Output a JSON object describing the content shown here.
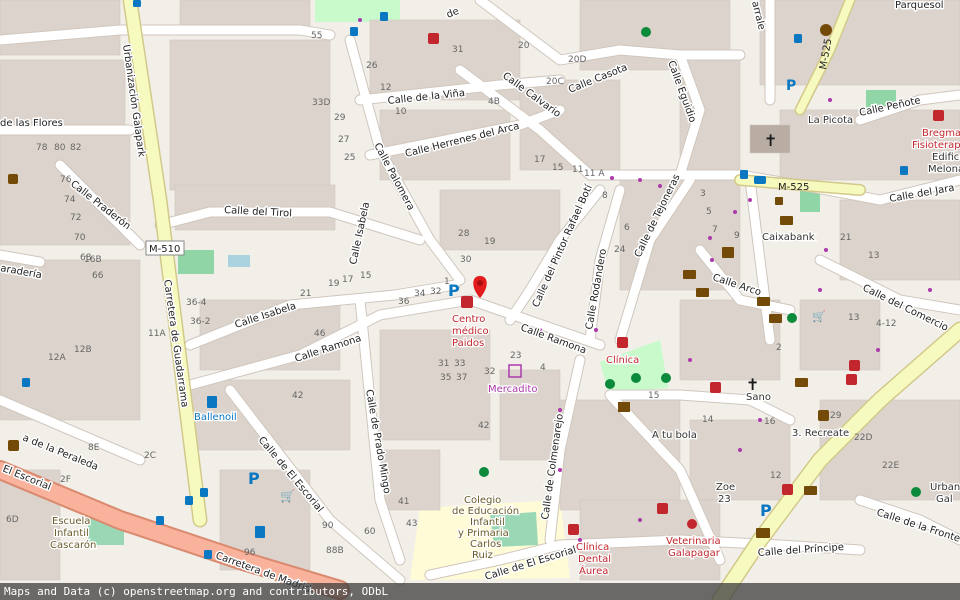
{
  "attribution": "Maps and Data (c) openstreetmap.org and contributors, ODbL",
  "colors": {
    "background": "#f2efe9",
    "building": "#d9d0c9",
    "road": "#ffffff",
    "major_road": "#f9b29c",
    "primary_road": "#f7fabf",
    "school_zone": "#fffbd6",
    "park": "#c8facc",
    "water": "#aad3df",
    "health": "#c2272d",
    "shop": "#ac39ac",
    "transit": "#0a77c2",
    "church": "#1b1b1b"
  },
  "streets": {
    "flores": "de las Flores",
    "galapark": "Urbanización Galapark",
    "praderon": "Calle Praderón",
    "pradera": "aradería",
    "tirol": "Calle del Tirol",
    "isabela_v": "Calle Isabela",
    "isabela_h": "Calle Isabela",
    "ramona_w": "Calle Ramona",
    "ramona_e": "Calle Ramona",
    "peraleda": "a de la Peraleda",
    "escorial_w": "El Escorial",
    "escorial_mid": "Calle de El Escorial",
    "escorial_s": "Calle de El Escorial",
    "guadarrama": "Carretera de Guadarrama",
    "madrid": "Carretera de Madrid",
    "prado_mingo": "Calle de Prado Mingo",
    "palomera": "Calle Palomera",
    "vina": "Calle de la Viña",
    "herrenes": "Calle Herrenes del Arca",
    "calvario": "Calle Calvario",
    "casota": "Calle Casota",
    "eguidio": "Calle Eguidio",
    "pintor": "Calle del Pintor Rafael Botí",
    "rodandero": "Calle Rodandero",
    "tejoneras": "Calle de Tejoneras",
    "arco": "Calle Arco",
    "colmenarejo": "Calle de Colmenarejo",
    "penote": "Calle Peñote",
    "jara": "Calle del Jara",
    "comercio": "Calle del Comercio",
    "principe": "Calle del Príncipe",
    "frontera": "Calle de la Fronte",
    "parque": "Parquesol",
    "arrale": "arrale",
    "de": "de"
  },
  "refs": {
    "m510": "M-510",
    "m525_top": "M-525",
    "m525": "M-525"
  },
  "pois": {
    "centro1": "Centro",
    "centro2": "médico",
    "centro3": "Paidos",
    "mercadito": "Mercadito",
    "clinica": "Clínica",
    "ballenoil": "Ballenoil",
    "caixabank": "Caixabank",
    "sano": "Sano",
    "atubola": "A tu bola",
    "recreate": "3. Recreate",
    "zoe1": "Zoe",
    "zoe2": "23",
    "picota": "La Picota",
    "bregma1": "Bregma",
    "bregma2": "Fisioterap",
    "edif1": "Edific",
    "edif2": "Melona",
    "urban1": "Urban",
    "urban2": "Gal",
    "colegio1": "Colegio",
    "colegio2": "de Educación",
    "colegio3": "Infantil",
    "colegio4": "y Primaria",
    "colegio5": "Carlos",
    "colegio6": "Ruiz",
    "escuela1": "Escuela",
    "escuela2": "Infantil",
    "escuela3": "Cascarón",
    "cd1": "Clínica",
    "cd2": "Dental",
    "cd3": "Áurea",
    "vet1": "Veterinaria",
    "vet2": "Galapagar"
  },
  "house_numbers": {
    "h1": "55",
    "h2": "31",
    "h3": "26",
    "h4": "12",
    "h5": "10",
    "h6": "33D",
    "h7": "29",
    "h8": "27",
    "h9": "25",
    "h10": "20",
    "h11": "4B",
    "h12": "20D",
    "h13": "20C",
    "h14": "19",
    "h15": "17",
    "h16": "15",
    "h17": "11",
    "h18": "11 A",
    "h19": "3",
    "h20": "5",
    "h21": "7",
    "h22": "9",
    "h23": "13",
    "h24": "15",
    "h25": "8",
    "h26": "6",
    "h27": "4",
    "h28": "2",
    "h29": "24",
    "h30": "28",
    "h31": "30",
    "h32": "1",
    "h33": "32",
    "h34": "34",
    "h35": "36",
    "h36": "78",
    "h37": "80",
    "h38": "82",
    "h39": "76",
    "h40": "74",
    "h41": "72",
    "h42": "70",
    "h43": "68",
    "h44": "66",
    "h45": "16B",
    "h46": "12B",
    "h47": "12A",
    "h48": "11A",
    "h49": "36-4",
    "h50": "36-2",
    "h51": "46",
    "h52": "42",
    "h53": "21",
    "h54": "19",
    "h55": "17",
    "h56": "15",
    "h57": "31",
    "h58": "33",
    "h59": "35",
    "h60": "37",
    "h61": "23",
    "h62": "32",
    "h63": "42",
    "h64": "41",
    "h65": "43",
    "h66": "90",
    "h67": "88B",
    "h68": "96",
    "h69": "60",
    "h70": "29",
    "h71": "22D",
    "h72": "22E",
    "h73": "16",
    "h74": "14",
    "h75": "4-12",
    "h76": "13",
    "h77": "21",
    "h78": "6D",
    "h79": "8E",
    "h80": "2C",
    "h81": "2F",
    "h82": "12"
  },
  "icons": [
    "bus-stop-icon",
    "parking-icon",
    "pharmacy-icon",
    "church-icon",
    "bank-icon",
    "atm-icon",
    "playground-icon",
    "fuel-icon",
    "shopping-cart-icon",
    "map-marker-icon",
    "sports-icon",
    "veterinary-icon",
    "courthouse-icon",
    "ev-charging-icon",
    "post-icon",
    "library-icon",
    "information-icon"
  ]
}
